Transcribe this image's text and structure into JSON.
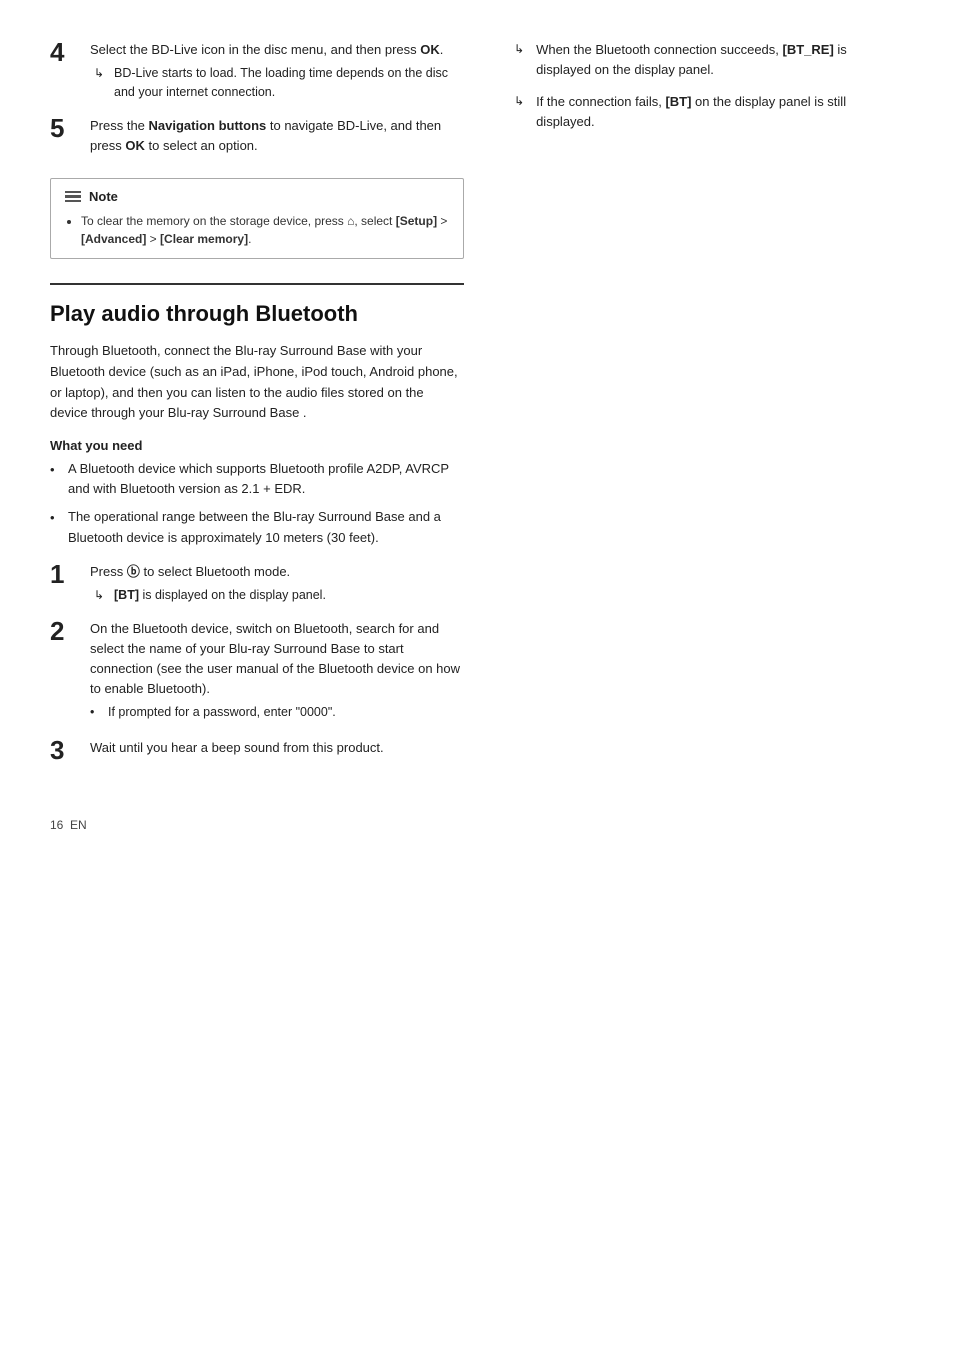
{
  "left": {
    "step4": {
      "number": "4",
      "main": "Select the BD-Live icon in the disc menu, and then press OK.",
      "sub": "BD-Live starts to load. The loading time depends on the disc and your internet connection."
    },
    "step5": {
      "number": "5",
      "main": "Press the Navigation buttons to navigate BD-Live, and then press OK to select an option."
    },
    "note": {
      "title": "Note",
      "item": "To clear the memory on the storage device, press ⌂, select [Setup] > [Advanced] > [Clear memory]."
    },
    "section_title": "Play audio through Bluetooth",
    "section_intro": "Through Bluetooth, connect the Blu-ray Surround Base  with your Bluetooth device (such as an iPad, iPhone, iPod touch, Android phone, or laptop), and then you can listen to the audio files stored on the device through your Blu-ray Surround Base .",
    "what_you_need": "What you need",
    "bullets": [
      "A Bluetooth device which supports Bluetooth profile A2DP, AVRCP and with Bluetooth version as 2.1 + EDR.",
      "The operational range between the Blu-ray Surround Base  and a Bluetooth device is approximately 10 meters (30 feet)."
    ],
    "bt_step1": {
      "number": "1",
      "main": "Press ⓑ to select Bluetooth mode.",
      "sub": "[BT] is displayed on the display panel."
    },
    "bt_step2": {
      "number": "2",
      "main": "On the Bluetooth device, switch on Bluetooth, search for and select the name of your Blu-ray Surround Base  to start connection (see the user manual of the Bluetooth device on how to enable Bluetooth).",
      "sub_bullet": "If prompted for a password, enter \"0000\"."
    },
    "bt_step3": {
      "number": "3",
      "main": "Wait until you hear a beep sound from this product."
    }
  },
  "right": {
    "arrow1": {
      "sym": "↳",
      "text": "When the Bluetooth connection succeeds, [BT_RE] is displayed on the display panel."
    },
    "arrow2": {
      "sym": "↳",
      "text": "If the connection fails, [BT] on the display panel is still displayed."
    }
  },
  "footer": {
    "page_num": "16",
    "lang": "EN"
  }
}
